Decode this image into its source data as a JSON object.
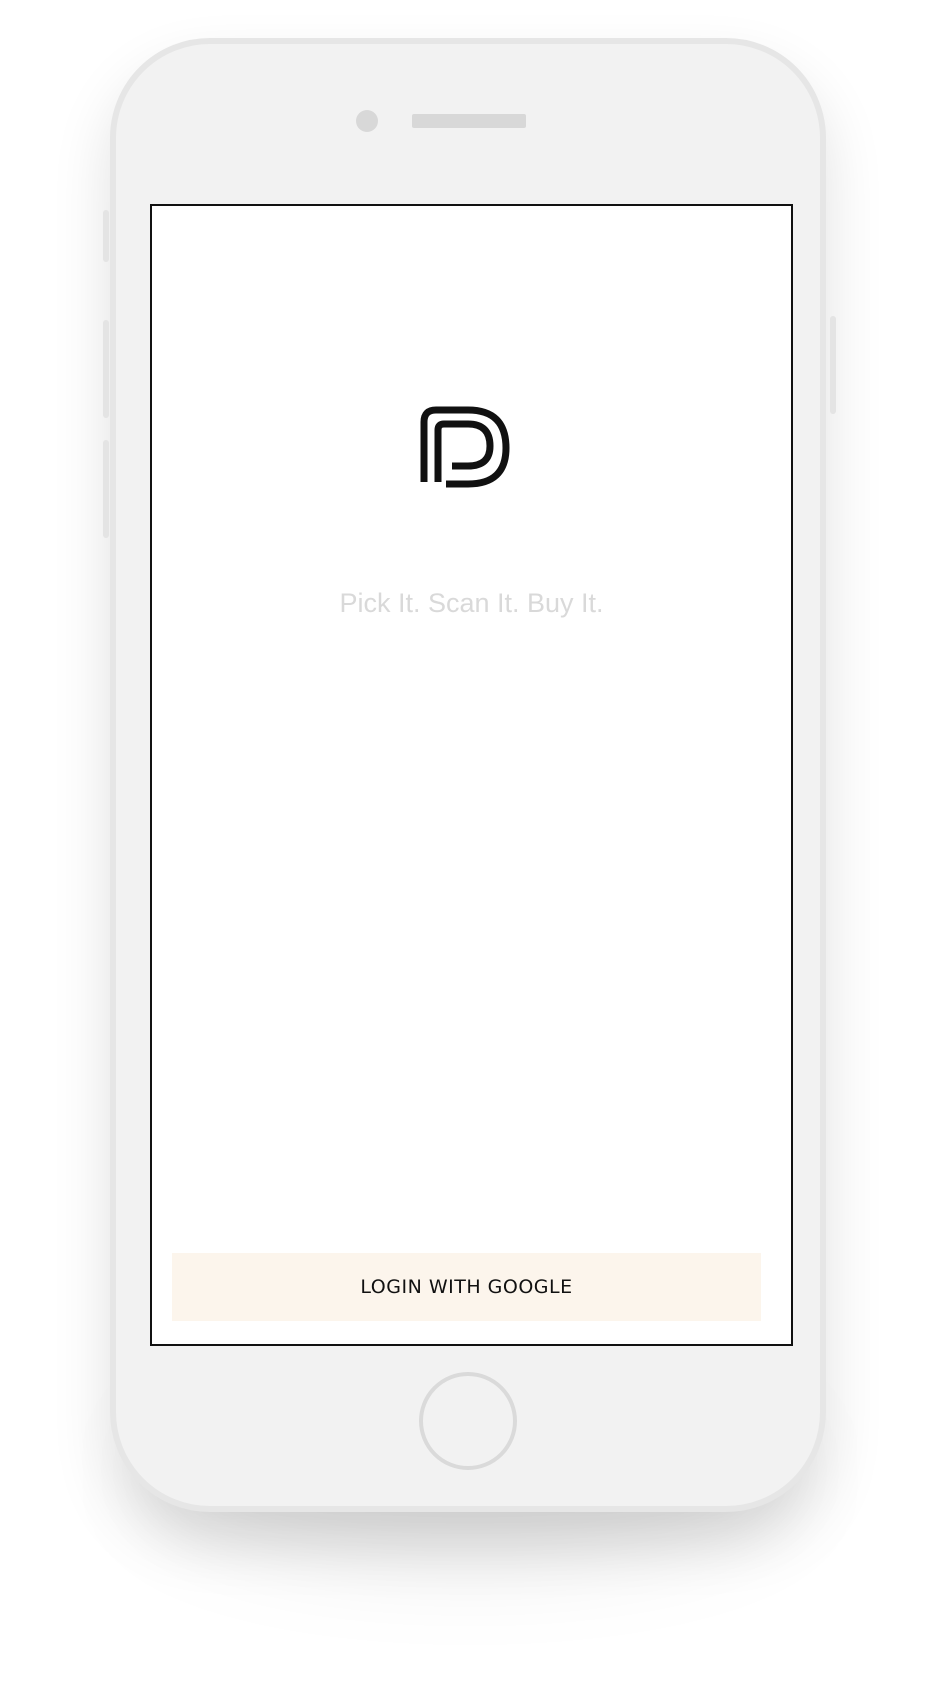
{
  "app": {
    "logo_icon": "dp-monogram-icon",
    "tagline": "Pick It. Scan It. Buy It."
  },
  "actions": {
    "login_label": "LOGIN WITH GOOGLE"
  },
  "device": {
    "frame_color": "#f2f2f2",
    "login_button_color": "#fcf5ec"
  }
}
